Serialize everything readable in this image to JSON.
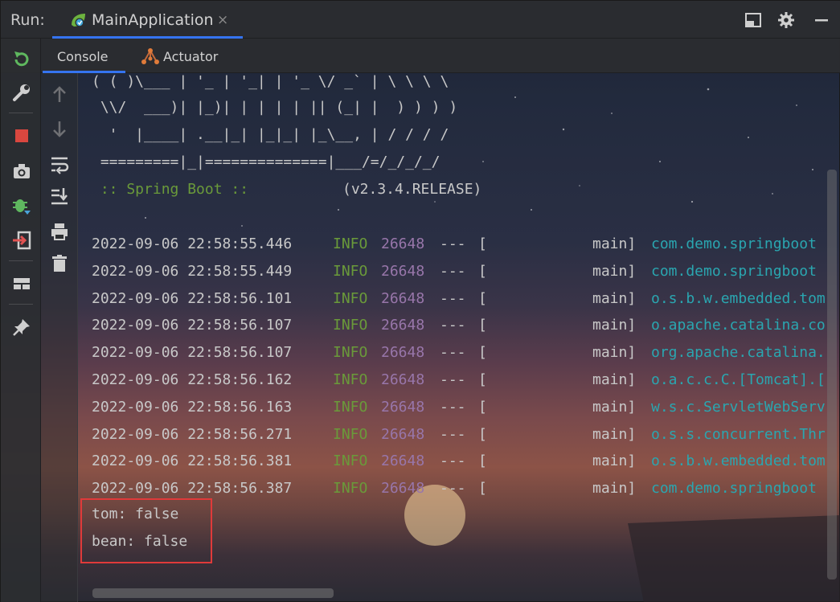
{
  "topbar": {
    "run_label": "Run:",
    "tab_title": "MainApplication",
    "close_glyph": "×",
    "icons": [
      "app-spring-icon",
      "layout-icon",
      "gear-icon",
      "minimize-icon"
    ]
  },
  "tabs": [
    {
      "label": "Console",
      "active": true
    },
    {
      "label": "Actuator",
      "active": false,
      "icon": "actuator-icon"
    }
  ],
  "sidebar_primary": [
    "rerun-icon",
    "wrench-icon",
    "stop-icon",
    "camera-icon",
    "bug-icon",
    "login-icon",
    "layout-icon",
    "pin-icon"
  ],
  "sidebar_secondary": [
    "arrow-up-icon",
    "arrow-down-icon",
    "soft-wrap-icon",
    "scroll-to-end-icon",
    "print-icon",
    "trash-icon"
  ],
  "console": {
    "banner": [
      "( ( )\\___ | '_ | '_| | '_ \\/ _` | \\ \\ \\ \\",
      " \\\\/  ___)| |_)| | | | | || (_| |  ) ) ) )",
      "  '  |____| .__|_| |_|_| |_\\__, | / / / /",
      " =========|_|==============|___/=/_/_/_/"
    ],
    "spring_boot_label": " :: Spring Boot ::",
    "spring_boot_version": "(v2.3.4.RELEASE)",
    "log_lines": [
      {
        "ts": "2022-09-06 22:58:55.446",
        "level": "INFO",
        "pid": "26648",
        "sep": "---",
        "bracket": "[",
        "thread": "main]",
        "logger": "com.demo.springboot"
      },
      {
        "ts": "2022-09-06 22:58:55.449",
        "level": "INFO",
        "pid": "26648",
        "sep": "---",
        "bracket": "[",
        "thread": "main]",
        "logger": "com.demo.springboot"
      },
      {
        "ts": "2022-09-06 22:58:56.101",
        "level": "INFO",
        "pid": "26648",
        "sep": "---",
        "bracket": "[",
        "thread": "main]",
        "logger": "o.s.b.w.embedded.tom"
      },
      {
        "ts": "2022-09-06 22:58:56.107",
        "level": "INFO",
        "pid": "26648",
        "sep": "---",
        "bracket": "[",
        "thread": "main]",
        "logger": "o.apache.catalina.co"
      },
      {
        "ts": "2022-09-06 22:58:56.107",
        "level": "INFO",
        "pid": "26648",
        "sep": "---",
        "bracket": "[",
        "thread": "main]",
        "logger": "org.apache.catalina."
      },
      {
        "ts": "2022-09-06 22:58:56.162",
        "level": "INFO",
        "pid": "26648",
        "sep": "---",
        "bracket": "[",
        "thread": "main]",
        "logger": "o.a.c.c.C.[Tomcat].["
      },
      {
        "ts": "2022-09-06 22:58:56.163",
        "level": "INFO",
        "pid": "26648",
        "sep": "---",
        "bracket": "[",
        "thread": "main]",
        "logger": "w.s.c.ServletWebServ"
      },
      {
        "ts": "2022-09-06 22:58:56.271",
        "level": "INFO",
        "pid": "26648",
        "sep": "---",
        "bracket": "[",
        "thread": "main]",
        "logger": "o.s.s.concurrent.Thr"
      },
      {
        "ts": "2022-09-06 22:58:56.381",
        "level": "INFO",
        "pid": "26648",
        "sep": "---",
        "bracket": "[",
        "thread": "main]",
        "logger": "o.s.b.w.embedded.tom"
      },
      {
        "ts": "2022-09-06 22:58:56.387",
        "level": "INFO",
        "pid": "26648",
        "sep": "---",
        "bracket": "[",
        "thread": "main]",
        "logger": "com.demo.springboot"
      }
    ],
    "output_lines": [
      "tom: false",
      "bean: false"
    ]
  },
  "colors": {
    "accent": "#3574f0",
    "info_green": "#6a9a3a",
    "pid_purple": "#9876aa",
    "logger_cyan": "#2aa6b0",
    "highlight_red": "#e03a3a",
    "stop_red": "#d9473f"
  }
}
